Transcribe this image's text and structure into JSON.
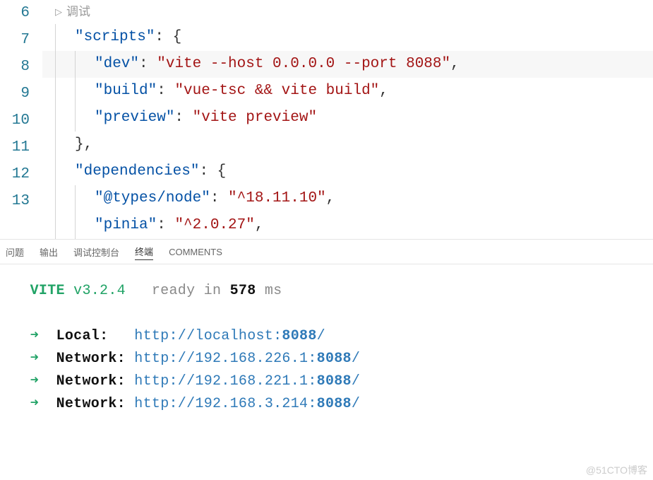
{
  "editor": {
    "codelens": "调试",
    "lines": [
      {
        "num": "6",
        "indent": 1,
        "tokens": [
          [
            "key",
            "\"scripts\""
          ],
          [
            "pun",
            ":"
          ],
          [
            "pun",
            " {"
          ]
        ]
      },
      {
        "num": "7",
        "indent": 2,
        "hl": true,
        "tokens": [
          [
            "key",
            "\"dev\""
          ],
          [
            "pun",
            ":"
          ],
          [
            "pun",
            " "
          ],
          [
            "str",
            "\"vite --host 0.0.0.0 --port 8088\""
          ],
          [
            "pun",
            ","
          ]
        ]
      },
      {
        "num": "8",
        "indent": 2,
        "tokens": [
          [
            "key",
            "\"build\""
          ],
          [
            "pun",
            ":"
          ],
          [
            "pun",
            " "
          ],
          [
            "str",
            "\"vue-tsc && vite build\""
          ],
          [
            "pun",
            ","
          ]
        ]
      },
      {
        "num": "9",
        "indent": 2,
        "tokens": [
          [
            "key",
            "\"preview\""
          ],
          [
            "pun",
            ":"
          ],
          [
            "pun",
            " "
          ],
          [
            "str",
            "\"vite preview\""
          ]
        ]
      },
      {
        "num": "10",
        "indent": 1,
        "tokens": [
          [
            "pun",
            "},"
          ]
        ]
      },
      {
        "num": "11",
        "indent": 1,
        "tokens": [
          [
            "key",
            "\"dependencies\""
          ],
          [
            "pun",
            ":"
          ],
          [
            "pun",
            " {"
          ]
        ]
      },
      {
        "num": "12",
        "indent": 2,
        "tokens": [
          [
            "key",
            "\"@types/node\""
          ],
          [
            "pun",
            ":"
          ],
          [
            "pun",
            " "
          ],
          [
            "str",
            "\"^18.11.10\""
          ],
          [
            "pun",
            ","
          ]
        ]
      },
      {
        "num": "13",
        "indent": 2,
        "tokens": [
          [
            "key",
            "\"pinia\""
          ],
          [
            "pun",
            ":"
          ],
          [
            "pun",
            " "
          ],
          [
            "str",
            "\"^2.0.27\""
          ],
          [
            "pun",
            ","
          ]
        ]
      }
    ]
  },
  "panel": {
    "tabs": [
      "问题",
      "输出",
      "调试控制台",
      "终端",
      "COMMENTS"
    ],
    "active": 3
  },
  "terminal": {
    "banner": {
      "name": "VITE",
      "version": "v3.2.4",
      "ready": "ready in",
      "ms": "578",
      "unit": "ms"
    },
    "rows": [
      {
        "label": "Local:",
        "space": "   ",
        "proto": "http://",
        "host": "localhost:",
        "port": "8088",
        "slash": "/"
      },
      {
        "label": "Network:",
        "space": " ",
        "proto": "http://",
        "host": "192.168.226.1:",
        "port": "8088",
        "slash": "/"
      },
      {
        "label": "Network:",
        "space": " ",
        "proto": "http://",
        "host": "192.168.221.1:",
        "port": "8088",
        "slash": "/"
      },
      {
        "label": "Network:",
        "space": " ",
        "proto": "http://",
        "host": "192.168.3.214:",
        "port": "8088",
        "slash": "/"
      }
    ]
  },
  "watermark": "@51CTO博客"
}
